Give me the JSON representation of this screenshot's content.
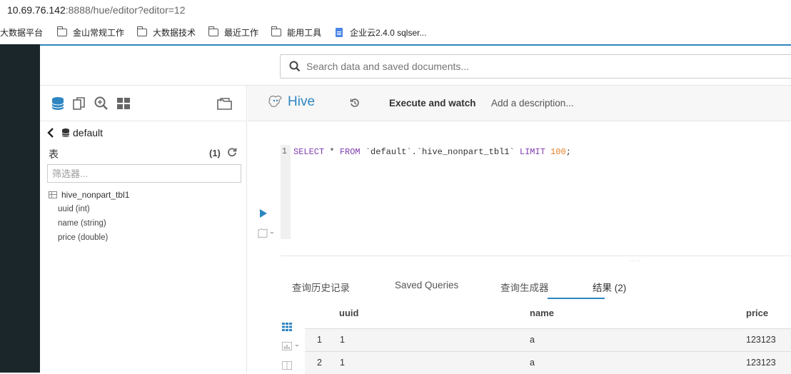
{
  "browser": {
    "url_host": "10.69.76.142",
    "url_rest": ":8888/hue/editor?editor=12",
    "bookmarks": [
      "大数据平台",
      "金山常规工作",
      "大数据技术",
      "最近工作",
      "能用工具",
      "企业云2.4.0 sqlser..."
    ]
  },
  "topbar": {
    "search_placeholder": "Search data and saved documents..."
  },
  "assist": {
    "database": "default",
    "tables_title": "表",
    "tables_count": "(1)",
    "filter_placeholder": "筛选器...",
    "table": {
      "name": "hive_nonpart_tbl1",
      "columns": [
        "uuid (int)",
        "name (string)",
        "price (double)"
      ]
    }
  },
  "editor": {
    "engine": "Hive",
    "execute_label": "Execute and watch",
    "description_placeholder": "Add a description...",
    "line_number": "1",
    "sql": {
      "kw1": "SELECT",
      "star": " * ",
      "kw2": "FROM",
      "table": " `default`.`hive_nonpart_tbl1` ",
      "kw3": "LIMIT",
      "limit": "100",
      "end": ";"
    }
  },
  "result_tabs": [
    {
      "label": "查询历史记录"
    },
    {
      "label": "Saved Queries"
    },
    {
      "label": "查询生成器"
    },
    {
      "label": "结果 (2)"
    }
  ],
  "results": {
    "columns": [
      "uuid",
      "name",
      "price"
    ],
    "rows": [
      {
        "index": "1",
        "uuid": "1",
        "name": "a",
        "price": "123123"
      },
      {
        "index": "2",
        "uuid": "1",
        "name": "a",
        "price": "123123"
      }
    ]
  },
  "colors": {
    "accent": "#2e86c1",
    "rail": "#1b262b",
    "keyword": "#7e3bb0",
    "number": "#e67e22"
  }
}
